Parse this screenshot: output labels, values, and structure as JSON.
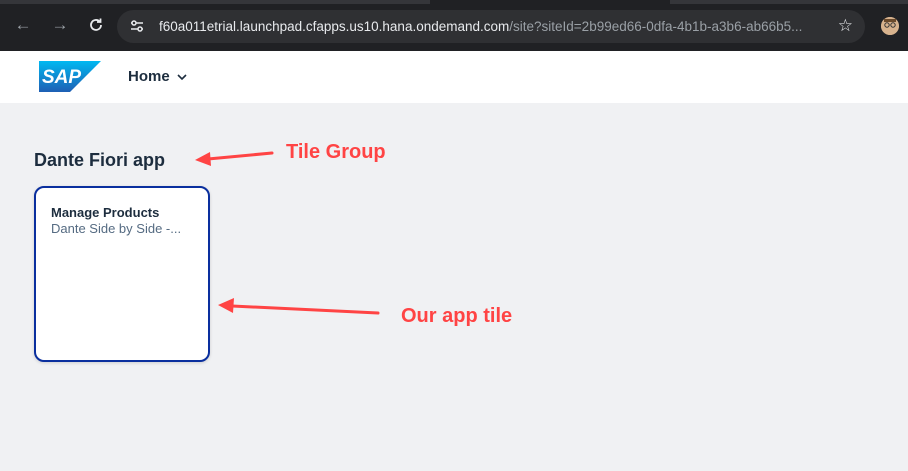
{
  "browser": {
    "url_main": "f60a011etrial.launchpad.cfapps.us10.hana.ondemand.com",
    "url_rest": "/site?siteId=2b99ed66-0dfa-4b1b-a3b6-ab66b5...",
    "icons": {
      "back": "arrow-left-icon",
      "forward": "arrow-right-icon",
      "reload": "reload-icon",
      "site_info": "tune-icon",
      "bookmark": "star-icon",
      "profile": "profile-avatar"
    }
  },
  "shell": {
    "logo_text": "SAP",
    "home_label": "Home",
    "logo_color": "#0a6ed1"
  },
  "content": {
    "group_title": "Dante Fiori app",
    "tiles": [
      {
        "title": "Manage Products",
        "subtitle": "Dante Side by Side -..."
      }
    ]
  },
  "annotations": {
    "tile_group_label": "Tile Group",
    "app_tile_label": "Our app tile",
    "color": "#ff4444"
  }
}
